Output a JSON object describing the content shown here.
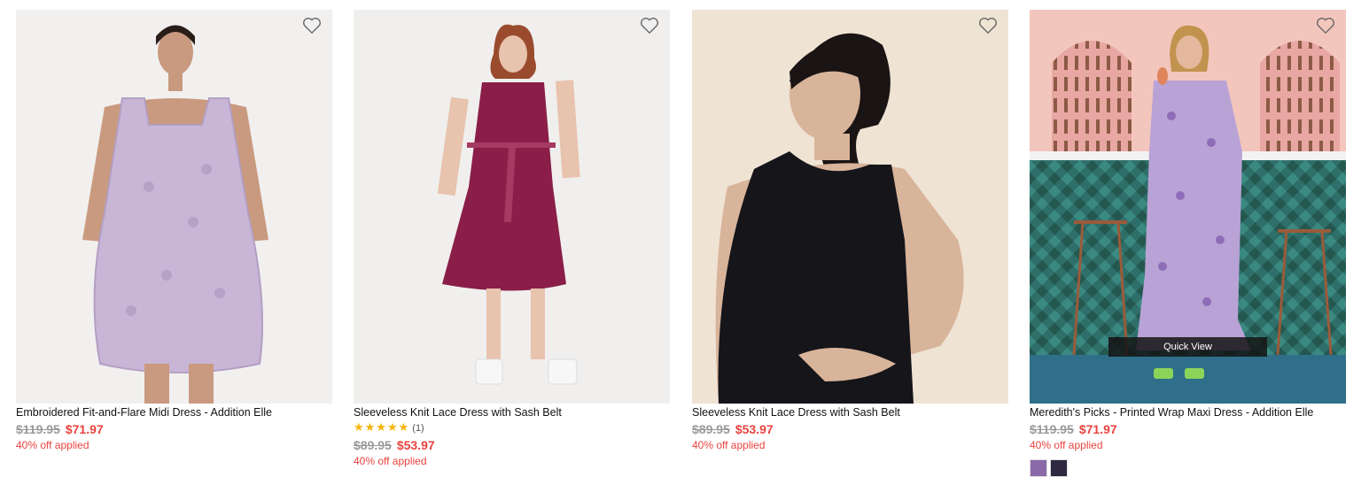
{
  "products": [
    {
      "name": "Embroidered Fit-and-Flare Midi Dress - Addition Elle",
      "old_price": "$119.95",
      "new_price": "$71.97",
      "promo": "40% off applied"
    },
    {
      "name": "Sleeveless Knit Lace Dress with Sash Belt",
      "stars": "★★★★★",
      "review_count": "(1)",
      "old_price": "$89.95",
      "new_price": "$53.97",
      "promo": "40% off applied"
    },
    {
      "name": "Sleeveless Knit Lace Dress with Sash Belt",
      "old_price": "$89.95",
      "new_price": "$53.97",
      "promo": "40% off applied"
    },
    {
      "name": "Meredith's Picks - Printed Wrap Maxi Dress - Addition Elle",
      "old_price": "$119.95",
      "new_price": "$71.97",
      "promo": "40% off applied",
      "quick_view": "Quick View",
      "swatches": [
        "#8a6aa8",
        "#2e2840"
      ]
    }
  ],
  "colors": {
    "sale_red": "#e8433f",
    "strike_gray": "#9a9a9a",
    "star_gold": "#f4b400"
  }
}
